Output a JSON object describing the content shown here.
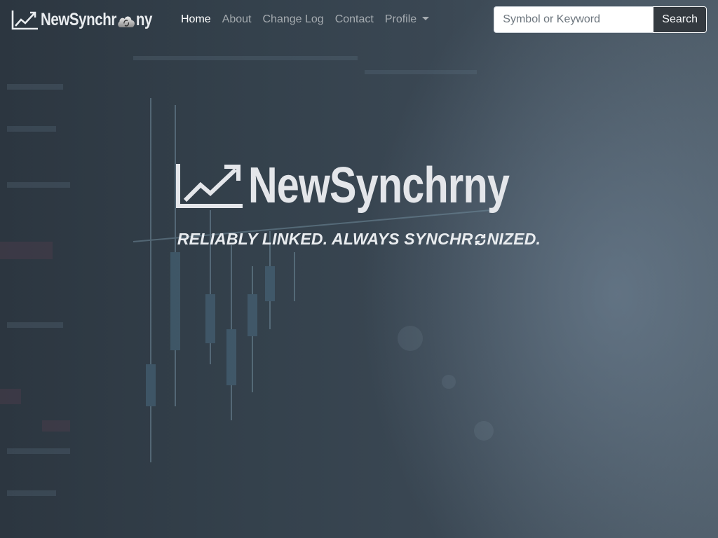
{
  "brand": {
    "name_before": "NewSynchr",
    "name_after": "ny",
    "logo_icons": [
      "trend-chart-icon",
      "sync-cloud-icon"
    ]
  },
  "nav": {
    "items": [
      {
        "label": "Home",
        "active": true
      },
      {
        "label": "About",
        "active": false
      },
      {
        "label": "Change Log",
        "active": false
      },
      {
        "label": "Contact",
        "active": false
      },
      {
        "label": "Profile",
        "active": false,
        "dropdown": true
      }
    ]
  },
  "search": {
    "placeholder": "Symbol or Keyword",
    "value": "",
    "button_label": "Search"
  },
  "hero": {
    "name_before": "NewSynchr",
    "name_after": "ny",
    "tagline_before": "RELIABLY LINKED. ALWAYS SYNCHR",
    "tagline_after": "NIZED."
  },
  "colors": {
    "navbar_text": "#ffffff",
    "nav_muted": "#9aa2a9",
    "button_bg": "#343a40",
    "hero_text": "#e4e6ea",
    "background": "#34414c"
  }
}
